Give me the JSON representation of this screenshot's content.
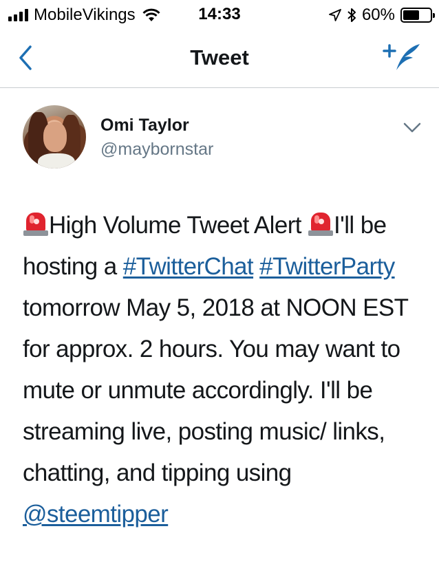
{
  "status_bar": {
    "carrier": "MobileVikings",
    "time": "14:33",
    "battery_percent": "60%",
    "battery_level": 0.6,
    "icons": [
      "signal-icon",
      "wifi-icon",
      "location-arrow-icon",
      "bluetooth-icon",
      "battery-icon"
    ]
  },
  "nav": {
    "title": "Tweet",
    "back_icon": "chevron-left-icon",
    "compose_icon": "compose-tweet-icon"
  },
  "tweet": {
    "author_name": "Omi Taylor",
    "author_handle": "@maybornstar",
    "text": {
      "t1": "High Volume Tweet Alert ",
      "t2": "I'll be hosting a ",
      "hashtag1": "#TwitterChat",
      "hashtag2": "#TwitterParty",
      "t3": " tomorrow May 5, 2018 at NOON EST for approx. 2 hours. You may want to mute or unmute accordingly. I'll be streaming live, posting music/ links, chatting, and tipping using ",
      "mention": "@steemtipper"
    },
    "emoji": "rotating-light-emoji"
  },
  "colors": {
    "link": "#1b5e9b",
    "accent": "#1da1f2",
    "handle": "#657786",
    "divider": "#c8ccd0"
  }
}
